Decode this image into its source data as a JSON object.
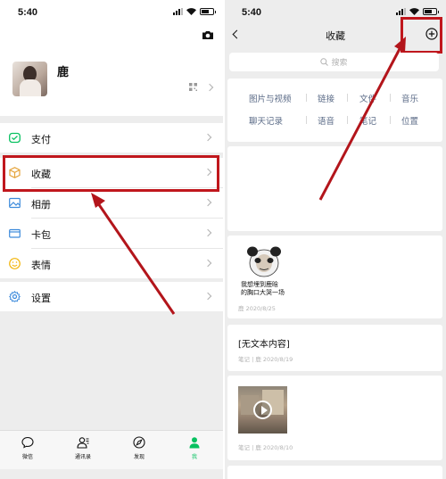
{
  "colors": {
    "accent_red": "#c0171d",
    "wechat_green": "#07c160",
    "link_gray": "#5b6b87"
  },
  "left": {
    "status_time": "5:40",
    "profile": {
      "name": "鹿",
      "icons": [
        "camera-icon",
        "qr-code-icon",
        "chevron-right-icon"
      ]
    },
    "menu": {
      "pay": {
        "label": "支付",
        "icon": "wallet-icon"
      },
      "favorites": {
        "label": "收藏",
        "icon": "cube-icon"
      },
      "album": {
        "label": "相册",
        "icon": "image-icon"
      },
      "cards": {
        "label": "卡包",
        "icon": "card-icon"
      },
      "stickers": {
        "label": "表情",
        "icon": "smiley-icon"
      },
      "settings": {
        "label": "设置",
        "icon": "gear-icon"
      }
    },
    "tabs": {
      "chats": "微信",
      "contacts": "通讯录",
      "discover": "发现",
      "me": "我"
    }
  },
  "right": {
    "status_time": "5:40",
    "title": "收藏",
    "search_placeholder": "搜索",
    "filters": {
      "row1": [
        "图片与视频",
        "链接",
        "文件",
        "音乐"
      ],
      "row2": [
        "聊天记录",
        "语音",
        "笔记",
        "位置"
      ]
    },
    "items": {
      "meme": {
        "caption_line1": "我想埋到鹿晗",
        "caption_line2": "的胸口大哭一场",
        "meta": "鹿 2020/8/25"
      },
      "note": {
        "title": "[无文本内容]",
        "meta": "笔记 | 鹿 2020/8/19"
      },
      "video": {
        "meta": "笔记 | 鹿 2020/8/10"
      }
    }
  }
}
